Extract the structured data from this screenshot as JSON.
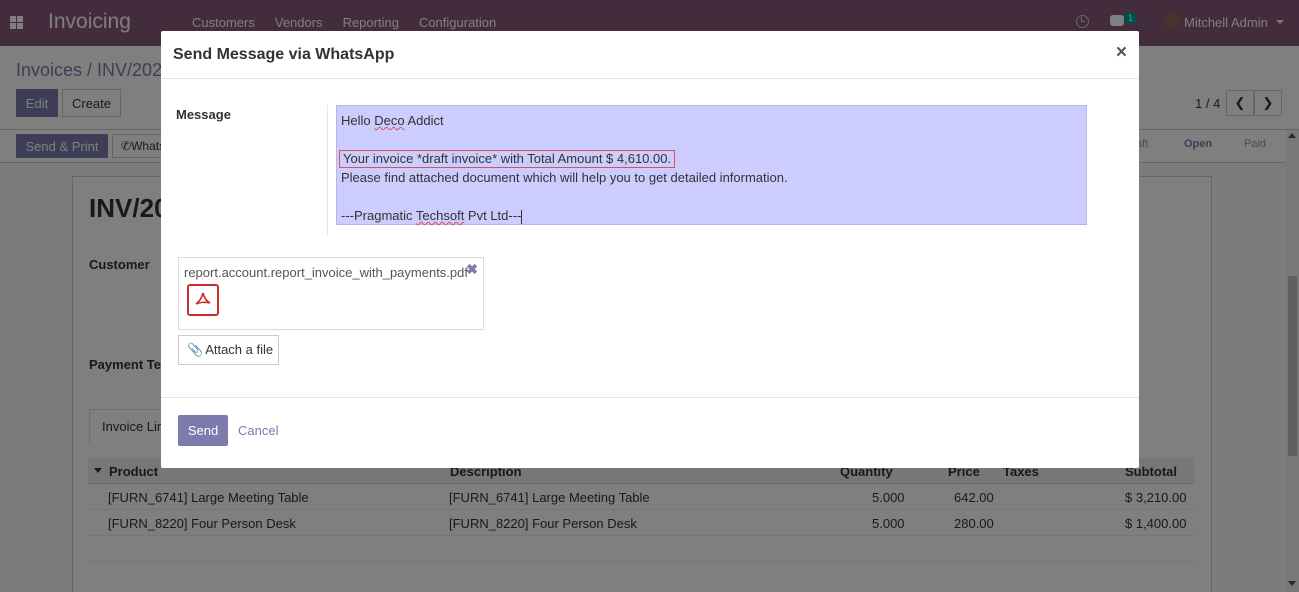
{
  "app": {
    "brand": "Invoicing",
    "menu": [
      "Customers",
      "Vendors",
      "Reporting",
      "Configuration"
    ],
    "chat_badge": "1",
    "user_name": "Mitchell Admin"
  },
  "control_panel": {
    "breadcrumb": "Invoices / INV/202",
    "edit_label": "Edit",
    "create_label": "Create",
    "pager": "1 / 4",
    "prev": "❮",
    "next": "❯"
  },
  "statusbar": {
    "send_print_label": "Send & Print",
    "whatsapp_label": "WhatsApp",
    "stages": [
      "Draft",
      "Open",
      "Paid"
    ],
    "stage_draft_visible": "aft"
  },
  "sheet": {
    "title": "INV/20",
    "customer_label": "Customer",
    "payment_label": "Payment Te",
    "tab_label": "Invoice Lin"
  },
  "table": {
    "headers": {
      "product": "Product",
      "description": "Description",
      "quantity": "Quantity",
      "price": "Price",
      "taxes": "Taxes",
      "subtotal": "Subtotal"
    },
    "rows": [
      {
        "product": "[FURN_6741] Large Meeting Table",
        "description": "[FURN_6741] Large Meeting Table",
        "quantity": "5.000",
        "price": "642.00",
        "subtotal": "$ 3,210.00"
      },
      {
        "product": "[FURN_8220] Four Person Desk",
        "description": "[FURN_8220] Four Person Desk",
        "quantity": "5.000",
        "price": "280.00",
        "subtotal": "$ 1,400.00"
      }
    ]
  },
  "modal": {
    "title": "Send Message via WhatsApp",
    "close": "×",
    "message_label": "Message",
    "message": {
      "line1_prefix": "Hello ",
      "line1_word": "Deco",
      "line1_suffix": " Addict",
      "line3": "Your invoice *draft invoice*  with Total Amount $ 4,610.00.",
      "line4": " Please find attached document which will help you to get detailed information.",
      "line6_prefix": "---Pragmatic ",
      "line6_word": "Techsoft",
      "line6_suffix": " Pvt Ltd---"
    },
    "attachment": {
      "filename": "report.account.report_invoice_with_payments.pdf",
      "remove": "✖"
    },
    "attach_label": "Attach a file",
    "send_label": "Send",
    "cancel_label": "Cancel"
  }
}
